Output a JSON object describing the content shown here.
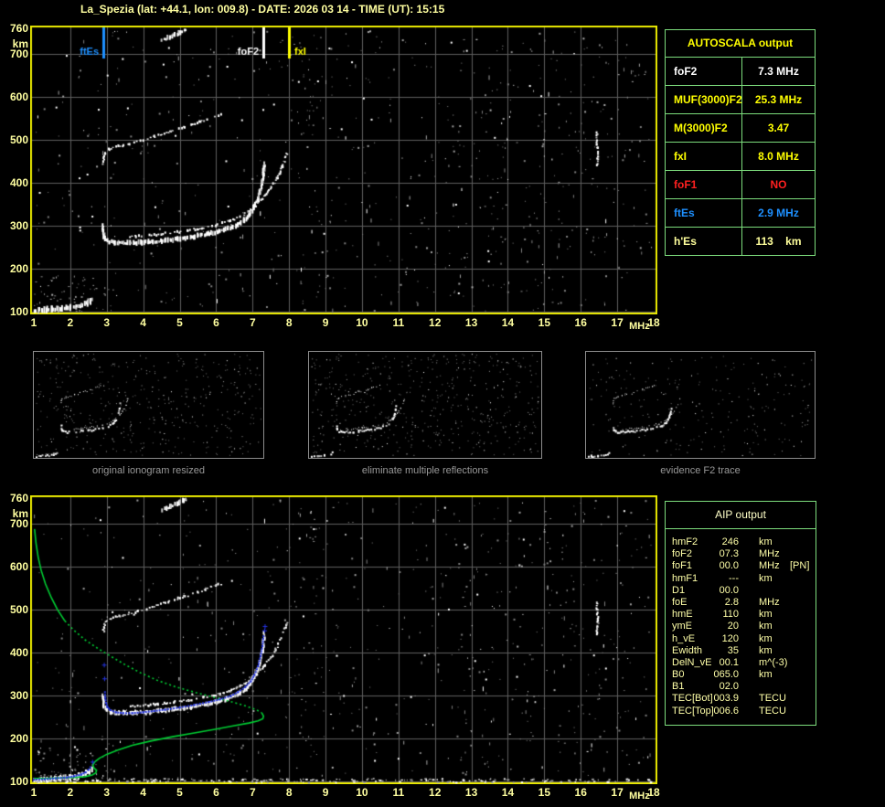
{
  "title": "La_Spezia (lat: +44.1, lon: 009.8) - DATE: 2026 03 14 - TIME (UT): 15:15",
  "autoscala": {
    "header": "AUTOSCALA output",
    "rows": [
      {
        "label": "foF2",
        "value": "7.3 MHz",
        "color": "#ffffff"
      },
      {
        "label": "MUF(3000)F2",
        "value": "25.3 MHz",
        "color": "#ffff00"
      },
      {
        "label": "M(3000)F2",
        "value": "3.47",
        "color": "#ffff00"
      },
      {
        "label": "fxI",
        "value": "8.0 MHz",
        "color": "#ffff00"
      },
      {
        "label": "foF1",
        "value": "NO",
        "color": "#ff2020"
      },
      {
        "label": "ftEs",
        "value": "2.9 MHz",
        "color": "#1e90ff"
      },
      {
        "label": "h'Es",
        "value": "113    km",
        "color": "#ffff9c"
      }
    ]
  },
  "aip": {
    "header": "AIP output",
    "rows": [
      {
        "label": "hmF2",
        "value": "246",
        "unit": "km",
        "note": ""
      },
      {
        "label": "foF2",
        "value": "07.3",
        "unit": "MHz",
        "note": ""
      },
      {
        "label": "foF1",
        "value": "00.0",
        "unit": "MHz",
        "note": "[PN]"
      },
      {
        "label": "hmF1",
        "value": "---",
        "unit": "km",
        "note": ""
      },
      {
        "label": "D1",
        "value": "00.0",
        "unit": "",
        "note": ""
      },
      {
        "label": "foE",
        "value": "2.8",
        "unit": "MHz",
        "note": ""
      },
      {
        "label": "hmE",
        "value": "110",
        "unit": "km",
        "note": ""
      },
      {
        "label": "ymE",
        "value": "20",
        "unit": "km",
        "note": ""
      },
      {
        "label": "h_vE",
        "value": "120",
        "unit": "km",
        "note": ""
      },
      {
        "label": "Ewidth",
        "value": "35",
        "unit": "km",
        "note": ""
      },
      {
        "label": "DelN_vE",
        "value": "00.1",
        "unit": "m^(-3)",
        "note": ""
      },
      {
        "label": "B0",
        "value": "065.0",
        "unit": "km",
        "note": ""
      },
      {
        "label": "B1",
        "value": "02.0",
        "unit": "",
        "note": ""
      },
      {
        "label": "TEC[Bot]",
        "value": "003.9",
        "unit": "TECU",
        "note": ""
      },
      {
        "label": "TEC[Top]",
        "value": "006.6",
        "unit": "TECU",
        "note": ""
      }
    ]
  },
  "thumbnails": [
    {
      "caption": "original ionogram resized"
    },
    {
      "caption": "eliminate multiple reflections"
    },
    {
      "caption": "evidence F2 trace"
    }
  ],
  "chart_data": {
    "type": "scatter",
    "x_label": "MHz",
    "y_label": "km",
    "x_range": [
      1,
      18
    ],
    "y_range": [
      100,
      760
    ],
    "x_ticks": [
      "1",
      "2",
      "3",
      "4",
      "5",
      "6",
      "7",
      "8",
      "9",
      "10",
      "11",
      "12",
      "13",
      "14",
      "15",
      "16",
      "17",
      "18"
    ],
    "y_ticks": [
      "760",
      "700",
      "600",
      "500",
      "400",
      "300",
      "200",
      "100"
    ],
    "markers": [
      {
        "label": "ftEs",
        "freq": 2.9,
        "color": "#1e90ff",
        "side": "left"
      },
      {
        "label": "foF2",
        "freq": 7.3,
        "color": "#ffffff",
        "side": "left"
      },
      {
        "label": "fxI",
        "freq": 8.0,
        "color": "#ffff00",
        "side": "right"
      }
    ],
    "traces": {
      "e_trace": [
        [
          1.0,
          103
        ],
        [
          1.2,
          104
        ],
        [
          1.45,
          105
        ],
        [
          1.7,
          107
        ],
        [
          1.95,
          109
        ],
        [
          2.15,
          112
        ],
        [
          2.3,
          116
        ],
        [
          2.45,
          121
        ],
        [
          2.55,
          128
        ]
      ],
      "f_trace_o": [
        [
          2.88,
          302
        ],
        [
          2.88,
          288
        ],
        [
          2.9,
          276
        ],
        [
          2.95,
          268
        ],
        [
          3.05,
          263
        ],
        [
          3.2,
          260
        ],
        [
          3.45,
          259
        ],
        [
          3.75,
          260
        ],
        [
          4.1,
          262
        ],
        [
          4.5,
          265
        ],
        [
          4.9,
          269
        ],
        [
          5.3,
          274
        ],
        [
          5.7,
          280
        ],
        [
          6.0,
          286
        ],
        [
          6.3,
          293
        ],
        [
          6.55,
          302
        ],
        [
          6.75,
          313
        ],
        [
          6.9,
          326
        ],
        [
          7.0,
          340
        ],
        [
          7.1,
          358
        ],
        [
          7.18,
          380
        ],
        [
          7.24,
          405
        ],
        [
          7.28,
          428
        ],
        [
          7.3,
          445
        ]
      ],
      "f_trace_x": [
        [
          3.6,
          275
        ],
        [
          4.0,
          277
        ],
        [
          4.4,
          280
        ],
        [
          4.8,
          284
        ],
        [
          5.2,
          289
        ],
        [
          5.6,
          295
        ],
        [
          6.0,
          302
        ],
        [
          6.35,
          311
        ],
        [
          6.65,
          322
        ],
        [
          6.9,
          335
        ],
        [
          7.1,
          350
        ],
        [
          7.3,
          368
        ],
        [
          7.5,
          390
        ],
        [
          7.65,
          412
        ],
        [
          7.78,
          436
        ],
        [
          7.88,
          458
        ],
        [
          7.92,
          470
        ]
      ],
      "second_hop": [
        [
          2.88,
          440
        ],
        [
          2.9,
          458
        ],
        [
          2.95,
          470
        ],
        [
          3.05,
          478
        ],
        [
          3.25,
          484
        ],
        [
          3.55,
          490
        ],
        [
          3.9,
          498
        ],
        [
          4.3,
          508
        ],
        [
          4.7,
          519
        ],
        [
          5.1,
          530
        ],
        [
          5.5,
          541
        ],
        [
          5.85,
          552
        ],
        [
          6.1,
          560
        ]
      ],
      "top_dash": [
        [
          4.5,
          733
        ],
        [
          4.7,
          740
        ],
        [
          4.95,
          749
        ],
        [
          5.15,
          757
        ]
      ],
      "streak_16": [
        [
          16.42,
          518
        ],
        [
          16.42,
          500
        ],
        [
          16.44,
          480
        ],
        [
          16.44,
          462
        ],
        [
          16.42,
          442
        ]
      ],
      "profile_green_top": [
        [
          1.02,
          688
        ],
        [
          1.06,
          655
        ],
        [
          1.12,
          622
        ],
        [
          1.2,
          592
        ],
        [
          1.32,
          560
        ],
        [
          1.48,
          528
        ],
        [
          1.65,
          500
        ],
        [
          1.85,
          474
        ]
      ],
      "profile_green_mid": [
        [
          1.85,
          474
        ],
        [
          2.1,
          452
        ],
        [
          2.4,
          430
        ],
        [
          2.75,
          410
        ],
        [
          3.1,
          392
        ],
        [
          3.5,
          372
        ],
        [
          3.95,
          352
        ],
        [
          4.4,
          335
        ],
        [
          4.9,
          320
        ],
        [
          5.4,
          308
        ],
        [
          5.9,
          297
        ],
        [
          6.4,
          286
        ],
        [
          6.8,
          276
        ],
        [
          7.1,
          267
        ],
        [
          7.25,
          260
        ]
      ],
      "profile_green_bot": [
        [
          7.25,
          260
        ],
        [
          7.3,
          252
        ],
        [
          7.28,
          246
        ],
        [
          7.15,
          241
        ],
        [
          6.9,
          236
        ],
        [
          6.5,
          230
        ],
        [
          6.0,
          222
        ],
        [
          5.4,
          213
        ],
        [
          4.8,
          204
        ],
        [
          4.2,
          194
        ],
        [
          3.7,
          184
        ],
        [
          3.3,
          173
        ],
        [
          3.0,
          163
        ],
        [
          2.8,
          154
        ],
        [
          2.68,
          146
        ],
        [
          2.62,
          138
        ],
        [
          2.65,
          131
        ],
        [
          2.72,
          126
        ],
        [
          2.7,
          120
        ],
        [
          2.6,
          115
        ],
        [
          2.4,
          111
        ],
        [
          2.1,
          109
        ],
        [
          1.7,
          108
        ],
        [
          1.3,
          107
        ],
        [
          1.0,
          107
        ]
      ],
      "fit_blue_e": [
        [
          1.0,
          104
        ],
        [
          1.3,
          105
        ],
        [
          1.6,
          107
        ],
        [
          1.9,
          109
        ],
        [
          2.1,
          112
        ],
        [
          2.3,
          116
        ],
        [
          2.42,
          121
        ],
        [
          2.5,
          127
        ],
        [
          2.55,
          133
        ]
      ],
      "fit_blue_f": [
        [
          2.95,
          308
        ],
        [
          2.96,
          295
        ],
        [
          2.98,
          283
        ],
        [
          3.02,
          273
        ],
        [
          3.1,
          266
        ],
        [
          3.25,
          261
        ],
        [
          3.45,
          259
        ],
        [
          3.7,
          259
        ],
        [
          4.0,
          261
        ],
        [
          4.3,
          264
        ],
        [
          4.6,
          267
        ],
        [
          5.0,
          272
        ],
        [
          5.4,
          278
        ],
        [
          5.8,
          285
        ],
        [
          6.1,
          291
        ],
        [
          6.4,
          299
        ],
        [
          6.6,
          308
        ],
        [
          6.8,
          320
        ],
        [
          6.95,
          333
        ],
        [
          7.05,
          348
        ],
        [
          7.15,
          368
        ],
        [
          7.22,
          392
        ],
        [
          7.27,
          415
        ],
        [
          7.3,
          438
        ]
      ],
      "fit_blue_marks": [
        [
          2.6,
          146
        ],
        [
          2.93,
          340
        ],
        [
          2.92,
          372
        ],
        [
          7.32,
          452
        ],
        [
          7.33,
          462
        ]
      ]
    },
    "colors": {
      "frame": "#e9e900",
      "grid": "#5e5e5e",
      "echo": "#ffffff",
      "profile": "#00cd32",
      "fit": "#2333e0"
    }
  }
}
